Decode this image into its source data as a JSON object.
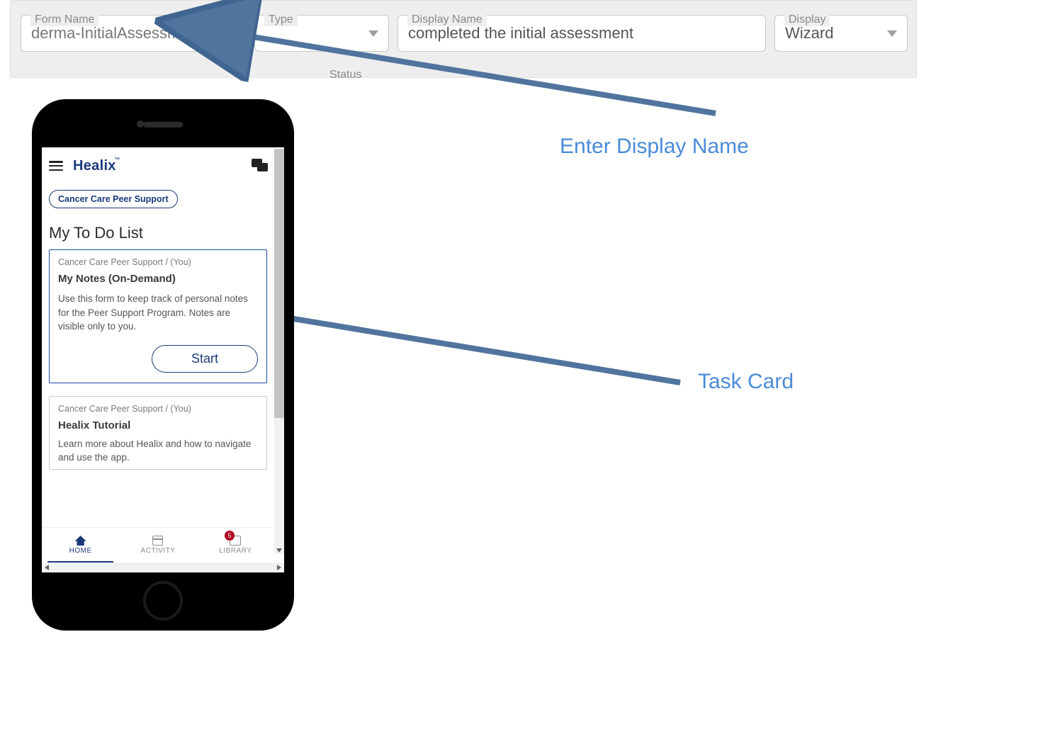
{
  "form_bar": {
    "form_name": {
      "label": "Form Name",
      "value": "derma-InitialAssessment_"
    },
    "type": {
      "label": "Type"
    },
    "display_name": {
      "label": "Display Name",
      "value": "completed the initial assessment"
    },
    "display": {
      "label": "Display",
      "value": "Wizard"
    },
    "status": {
      "label": "Status"
    }
  },
  "annotations": {
    "enter_display_name": "Enter Display Name",
    "task_card": "Task Card"
  },
  "app": {
    "brand": "Healix",
    "chip": "Cancer Care Peer Support",
    "todo_heading": "My To Do List",
    "card1": {
      "breadcrumb": "Cancer Care Peer Support / (You)",
      "title": "My Notes (On-Demand)",
      "desc": "Use this form to keep track of personal notes for the Peer Support Program. Notes are visible only to you.",
      "start": "Start"
    },
    "card2": {
      "breadcrumb": "Cancer Care Peer Support / (You)",
      "title": "Healix Tutorial",
      "desc": "Learn more about Healix and how to navigate and use the app."
    },
    "nav": {
      "home": "HOME",
      "activity": "ACTIVITY",
      "library": "LIBRARY",
      "library_badge": "5"
    }
  }
}
